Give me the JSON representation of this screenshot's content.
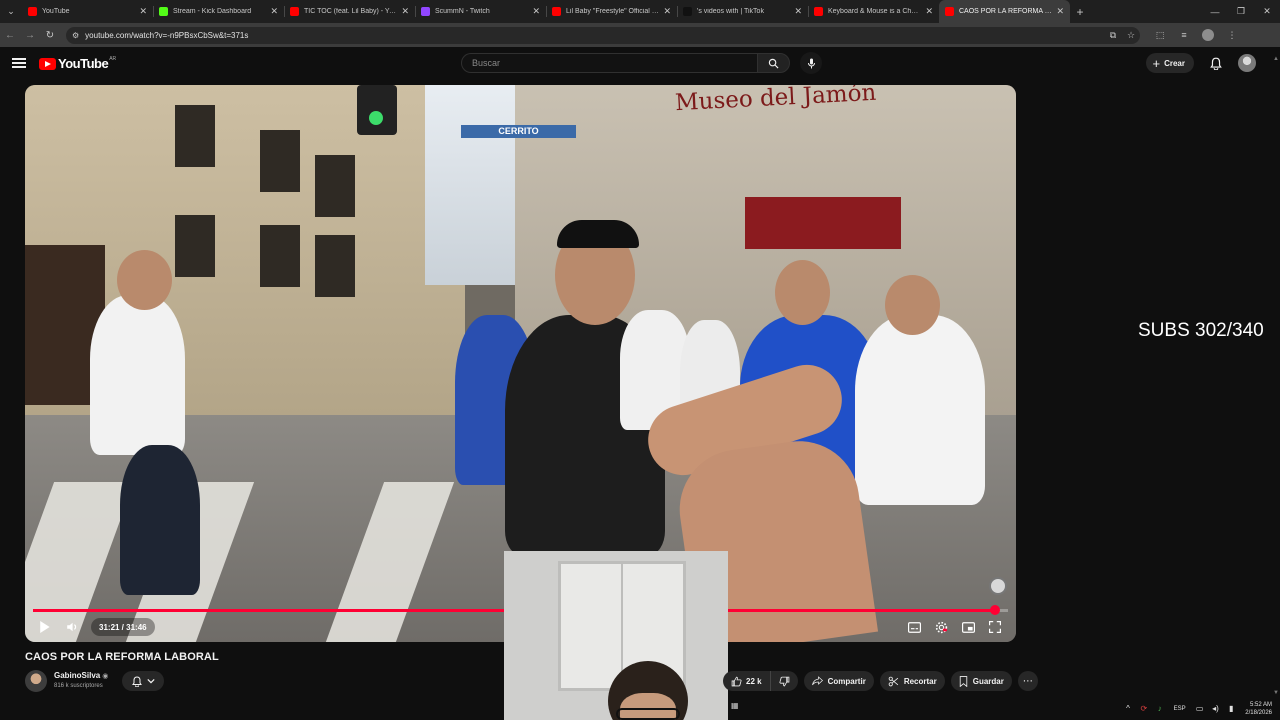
{
  "browser": {
    "tabs": [
      {
        "title": "YouTube",
        "favicon_color": "#ff0000",
        "active": false
      },
      {
        "title": "Stream - Kick Dashboard",
        "favicon_color": "#53fc18",
        "active": false
      },
      {
        "title": "TIC TOC (feat. Lil Baby) - YouTube",
        "favicon_color": "#ff0000",
        "active": false
      },
      {
        "title": "ScummN - Twitch",
        "favicon_color": "#9146ff",
        "active": false
      },
      {
        "title": "Lil Baby \"Freestyle\" Official Music",
        "favicon_color": "#ff0000",
        "active": false
      },
      {
        "title": "'s videos with | TikTok",
        "favicon_color": "#111111",
        "active": false
      },
      {
        "title": "Keyboard & Mouse is a Cheat Code",
        "favicon_color": "#ff0000",
        "active": false
      },
      {
        "title": "CAOS POR LA REFORMA LABORAL",
        "favicon_color": "#ff0000",
        "active": true
      }
    ],
    "url": "youtube.com/watch?v=-n9PBsxCbSw&t=371s"
  },
  "youtube": {
    "logo_text": "YouTube",
    "country_code": "AR",
    "search_placeholder": "Buscar",
    "create_label": "Crear"
  },
  "video": {
    "title": "CAOS POR LA REFORMA LABORAL",
    "current_time": "31:21",
    "duration": "31:46",
    "time_display": "31:21 / 31:46",
    "progress_fraction": 0.987,
    "overlay_text": "SUBS 302/340",
    "scene_sign": "Museo del Jamón",
    "scene_street_sign": "CERRITO",
    "accent_color": "#ff0033"
  },
  "channel": {
    "name": "GabinoSilva",
    "subscribers": "816 k suscriptores"
  },
  "actions": {
    "likes": "22 k",
    "share_label": "Compartir",
    "clip_label": "Recortar",
    "save_label": "Guardar"
  },
  "system": {
    "language": "ESP",
    "time": "5:52 AM",
    "date": "2/18/2026"
  }
}
